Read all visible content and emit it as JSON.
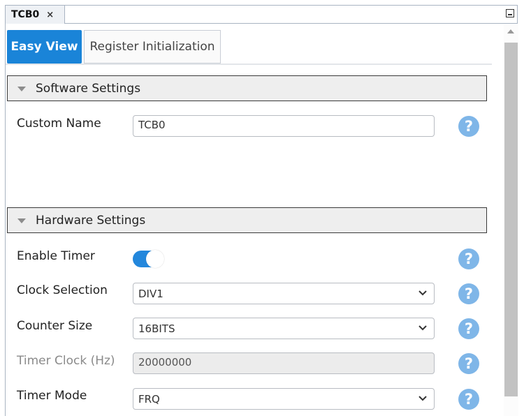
{
  "doc_tab": {
    "title": "TCB0",
    "close_glyph": "×"
  },
  "view_tabs": [
    {
      "label": "Easy View",
      "active": true
    },
    {
      "label": "Register Initialization",
      "active": false
    }
  ],
  "software_settings": {
    "title": "Software Settings",
    "custom_name": {
      "label": "Custom Name",
      "value": "TCB0"
    }
  },
  "hardware_settings": {
    "title": "Hardware Settings",
    "enable_timer": {
      "label": "Enable Timer",
      "on": true
    },
    "clock_selection": {
      "label": "Clock Selection",
      "value": "DIV1"
    },
    "counter_size": {
      "label": "Counter Size",
      "value": "16BITS"
    },
    "timer_clock": {
      "label": "Timer Clock (Hz)",
      "value": "20000000"
    },
    "timer_mode": {
      "label": "Timer Mode",
      "value": "FRQ"
    }
  },
  "help_glyph": "?",
  "colors": {
    "accent": "#1a84d8",
    "help": "#7fb6e8",
    "toggle": "#2387dc"
  }
}
